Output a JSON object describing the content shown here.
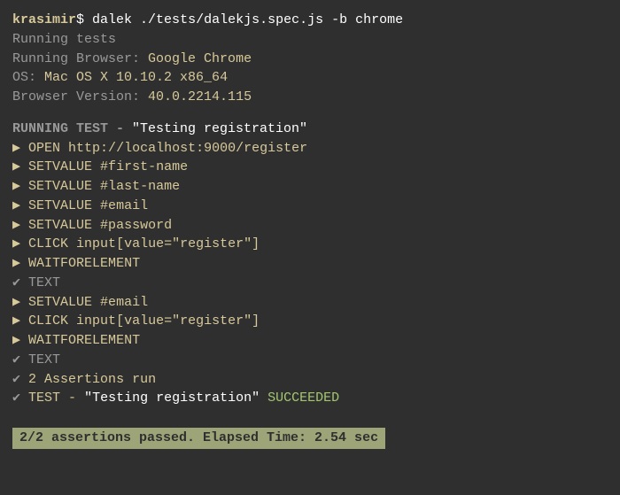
{
  "prompt": {
    "user": "krasimir",
    "symbol": "$",
    "command": "dalek ./tests/dalekjs.spec.js -b chrome"
  },
  "header": {
    "running_tests": "Running tests",
    "running_browser_label": "Running Browser:",
    "running_browser_value": "Google Chrome",
    "os_label": "OS:",
    "os_value": "Mac OS X 10.10.2 x86_64",
    "browser_version_label": "Browser Version:",
    "browser_version_value": "40.0.2214.115"
  },
  "test": {
    "running_test_label": "RUNNING TEST - ",
    "test_name": "\"Testing registration\"",
    "steps": [
      {
        "marker": "▶",
        "text": "OPEN http://localhost:9000/register",
        "type": "step"
      },
      {
        "marker": "▶",
        "text": "SETVALUE #first-name",
        "type": "step"
      },
      {
        "marker": "▶",
        "text": "SETVALUE #last-name",
        "type": "step"
      },
      {
        "marker": "▶",
        "text": "SETVALUE #email",
        "type": "step"
      },
      {
        "marker": "▶",
        "text": "SETVALUE #password",
        "type": "step"
      },
      {
        "marker": "▶",
        "text": "CLICK input[value=\"register\"]",
        "type": "step"
      },
      {
        "marker": "▶",
        "text": "WAITFORELEMENT",
        "type": "step"
      },
      {
        "marker": "✔",
        "text": "TEXT",
        "type": "check"
      },
      {
        "marker": "▶",
        "text": "SETVALUE #email",
        "type": "step"
      },
      {
        "marker": "▶",
        "text": "CLICK input[value=\"register\"]",
        "type": "step"
      },
      {
        "marker": "▶",
        "text": "WAITFORELEMENT",
        "type": "step"
      },
      {
        "marker": "✔",
        "text": "TEXT",
        "type": "check"
      },
      {
        "marker": "✔",
        "text": "2 Assertions run",
        "type": "assert"
      }
    ],
    "result": {
      "marker": "✔",
      "label": "TEST - ",
      "name": "\"Testing registration\"",
      "status": "SUCCEEDED"
    }
  },
  "summary": "2/2 assertions passed. Elapsed Time: 2.54 sec"
}
